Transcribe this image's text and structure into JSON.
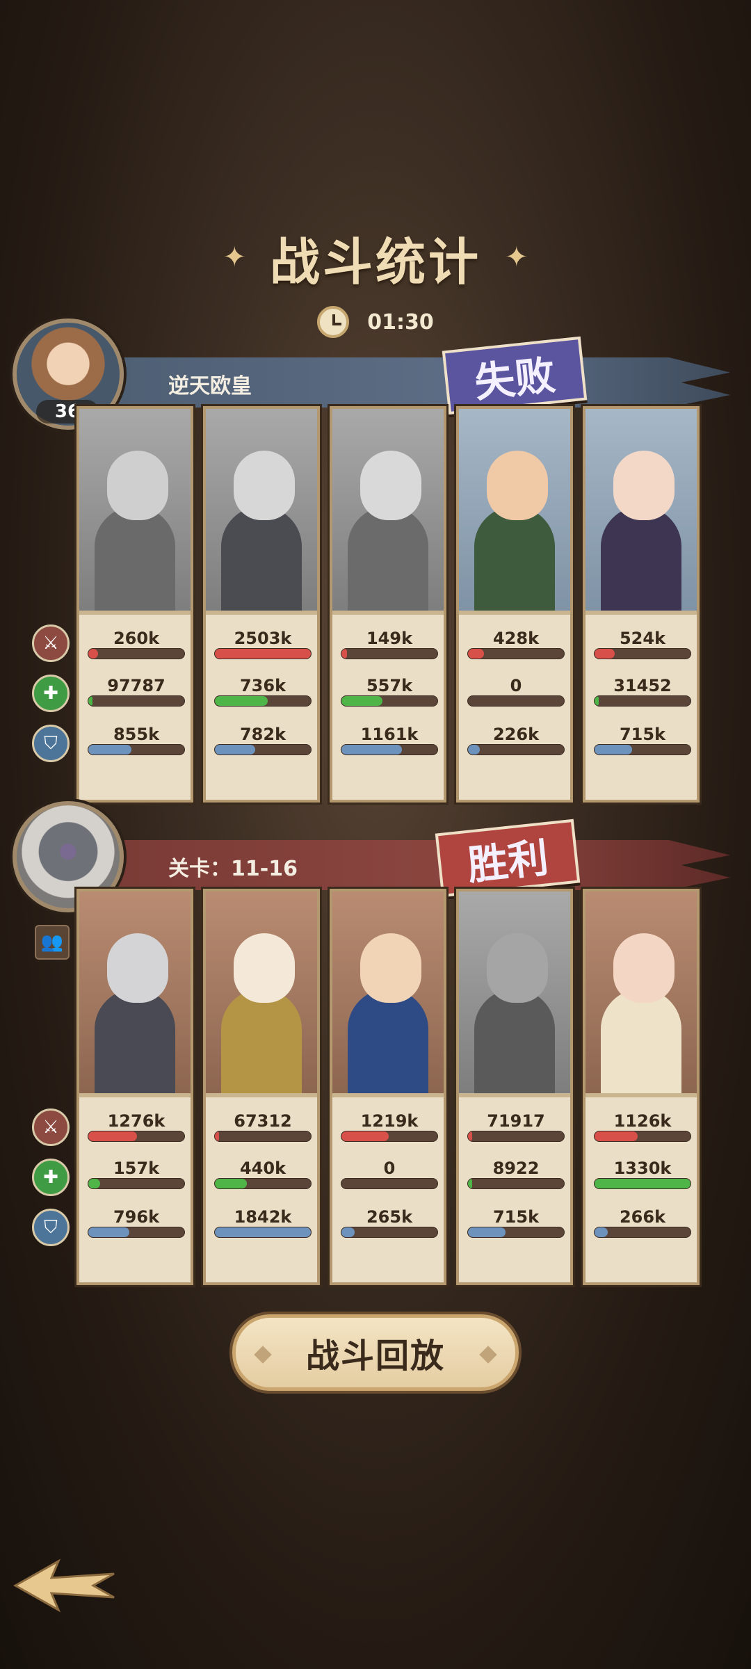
{
  "header": {
    "title": "战斗统计",
    "timer": "01:30"
  },
  "player": {
    "name": "逆天欧皇",
    "level": "36",
    "result": "失败",
    "heroes": [
      {
        "dmg": "260k",
        "heal": "97787",
        "def": "855k",
        "dmg_p": 0.1,
        "heal_p": 0.04,
        "def_p": 0.45,
        "tone": "gray",
        "c1": "#6a6a6a",
        "c2": "#cfcfcf"
      },
      {
        "dmg": "2503k",
        "heal": "736k",
        "def": "782k",
        "dmg_p": 1.0,
        "heal_p": 0.55,
        "def_p": 0.42,
        "tone": "gray",
        "c1": "#4b4b52",
        "c2": "#d7d7d7"
      },
      {
        "dmg": "149k",
        "heal": "557k",
        "def": "1161k",
        "dmg_p": 0.06,
        "heal_p": 0.43,
        "def_p": 0.63,
        "tone": "gray",
        "c1": "#6b6b6b",
        "c2": "#d9d9d9"
      },
      {
        "dmg": "428k",
        "heal": "0",
        "def": "226k",
        "dmg_p": 0.17,
        "heal_p": 0.0,
        "def_p": 0.12,
        "tone": "color",
        "c1": "#3f5b3d",
        "c2": "#f0caa7"
      },
      {
        "dmg": "524k",
        "heal": "31452",
        "def": "715k",
        "dmg_p": 0.21,
        "heal_p": 0.02,
        "def_p": 0.39,
        "tone": "color",
        "c1": "#3d3552",
        "c2": "#f3d8c8"
      }
    ]
  },
  "enemy": {
    "name": "关卡：11-16",
    "result": "胜利",
    "heroes": [
      {
        "dmg": "1276k",
        "heal": "157k",
        "def": "796k",
        "dmg_p": 0.51,
        "heal_p": 0.12,
        "def_p": 0.43,
        "tone": "color",
        "c1": "#4a4a55",
        "c2": "#d4d4d6"
      },
      {
        "dmg": "67312",
        "heal": "440k",
        "def": "1842k",
        "dmg_p": 0.03,
        "heal_p": 0.33,
        "def_p": 1.0,
        "tone": "color",
        "c1": "#b49545",
        "c2": "#f4e8d8"
      },
      {
        "dmg": "1219k",
        "heal": "0",
        "def": "265k",
        "dmg_p": 0.49,
        "heal_p": 0.0,
        "def_p": 0.14,
        "tone": "color",
        "c1": "#2f4b86",
        "c2": "#f1d3b5"
      },
      {
        "dmg": "71917",
        "heal": "8922",
        "def": "715k",
        "dmg_p": 0.03,
        "heal_p": 0.01,
        "def_p": 0.39,
        "tone": "gray",
        "c1": "#5a5a5a",
        "c2": "#a5a5a5"
      },
      {
        "dmg": "1126k",
        "heal": "1330k",
        "def": "266k",
        "dmg_p": 0.45,
        "heal_p": 1.0,
        "def_p": 0.14,
        "tone": "color",
        "c1": "#eee2c8",
        "c2": "#f3d6c4"
      }
    ]
  },
  "actions": {
    "replay": "战斗回放"
  },
  "icons": {
    "attack": "sword-icon",
    "heal": "heal-plus-icon",
    "defense": "shield-icon",
    "team": "team-icon",
    "back": "back-arrow-icon",
    "clock": "clock-icon"
  },
  "colors": {
    "damage": "#d8504a",
    "heal": "#4fb548",
    "defense": "#6d93bd",
    "lose": "#5b55a0",
    "win": "#b0443e"
  }
}
